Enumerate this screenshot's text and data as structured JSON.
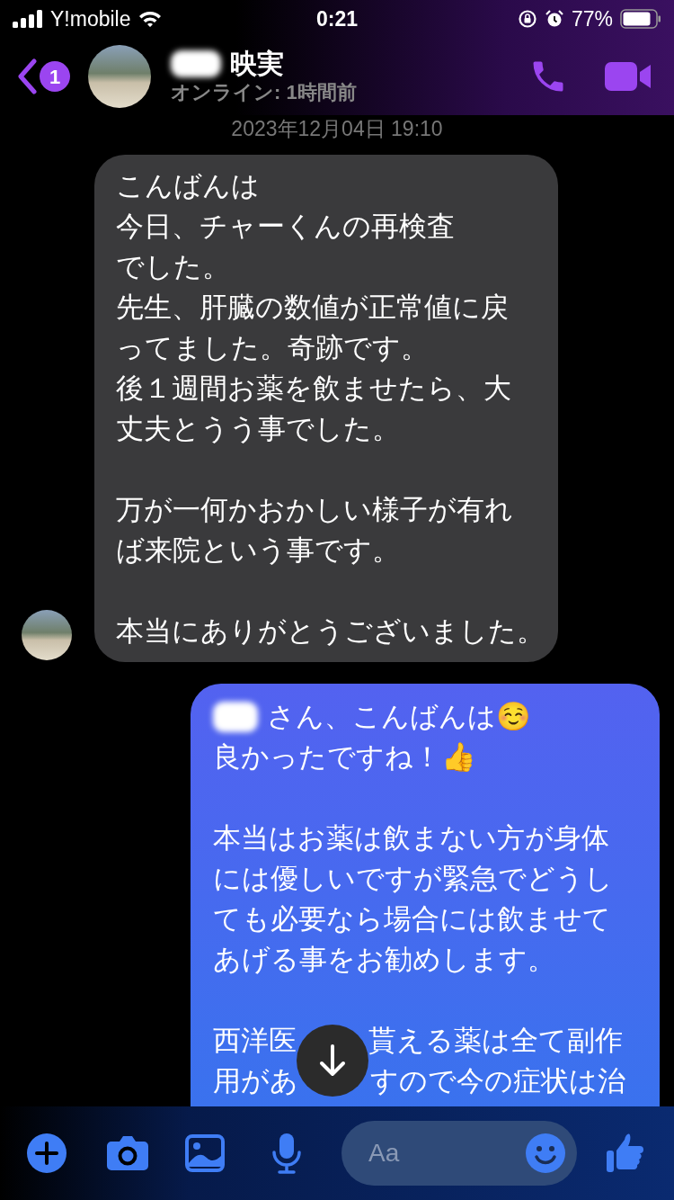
{
  "status_bar": {
    "carrier": "Y!mobile",
    "time": "0:21",
    "battery": "77%"
  },
  "header": {
    "back_badge": "1",
    "contact_name": "映実",
    "presence": "オンライン: 1時間前"
  },
  "timestamp": "2023年12月04日 19:10",
  "messages": [
    {
      "kind": "received",
      "redacted_start": false,
      "paragraphs": [
        [
          [
            "こんばんは"
          ],
          [
            "今日、チャーくんの再検査"
          ],
          [
            "でした。"
          ],
          [
            "先生、肝臓の数値が正常値に戻"
          ],
          [
            "ってました。奇跡です。"
          ],
          [
            "後１週間お薬を飲ませたら、大"
          ],
          [
            "丈夫とうう事でした。"
          ]
        ],
        [
          [
            "万が一何かおかしい様子が有れ"
          ],
          [
            "ば来院という事です。"
          ]
        ],
        [
          [
            "本当にありがとうございました。"
          ]
        ]
      ]
    },
    {
      "kind": "sent",
      "redacted_start": true,
      "paragraphs": [
        [
          [
            "さん、こんばんは☺️"
          ],
          [
            "良かったですね！👍"
          ]
        ],
        [
          [
            "本当はお薬は飲まない方が身体"
          ],
          [
            "には優しいですが緊急でどうし"
          ],
          [
            "ても必要なら場合には飲ませて"
          ],
          [
            "あげる事をお勧めします。"
          ]
        ],
        [
          [
            "西洋医",
            "貰える薬は全て副作"
          ],
          [
            "用があ",
            "すので今の症状は治"
          ]
        ]
      ]
    }
  ],
  "composer": {
    "placeholder": "Aa"
  }
}
